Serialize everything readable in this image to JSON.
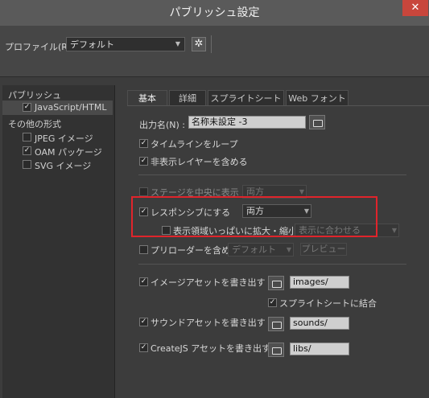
{
  "window": {
    "title": "パブリッシュ設定",
    "close_symbol": "✕"
  },
  "profile": {
    "label": "プロファイル(R) :",
    "value": "デフォルト",
    "arrow": "▼",
    "gear": "✲"
  },
  "sidebar": {
    "publish_header": "パブリッシュ",
    "js_html": {
      "label": "JavaScript/HTML",
      "checked": true
    },
    "other_header": "その他の形式",
    "jpeg": {
      "label": "JPEG イメージ",
      "checked": false
    },
    "oam": {
      "label": "OAM パッケージ",
      "checked": true
    },
    "svg": {
      "label": "SVG イメージ",
      "checked": false
    }
  },
  "tabs": [
    "基本",
    "詳細",
    "スプライトシート",
    "Web フォント"
  ],
  "basic": {
    "output_label": "出力名(N) :",
    "output_value": "名称未設定 -3",
    "loop_timeline": {
      "label": "タイムラインをループ",
      "checked": true
    },
    "include_hidden": {
      "label": "非表示レイヤーを含める",
      "checked": true
    },
    "center_stage": {
      "label": "ステージを中央に表示",
      "checked": false,
      "dropdown": "両方"
    },
    "responsive": {
      "label": "レスポンシブにする",
      "checked": true,
      "dropdown": "両方"
    },
    "scale_fill": {
      "label": "表示領域いっぱいに拡大・縮小",
      "checked": false,
      "dropdown": "表示に合わせる"
    },
    "preloader": {
      "label": "プリローダーを含める",
      "checked": false,
      "dropdown": "デフォルト",
      "preview_button": "プレビュー"
    },
    "export_images": {
      "label": "イメージアセットを書き出す :",
      "checked": true,
      "path": "images/"
    },
    "combine_sprites": {
      "label": "スプライトシートに結合",
      "checked": true
    },
    "export_sounds": {
      "label": "サウンドアセットを書き出す :",
      "checked": true,
      "path": "sounds/"
    },
    "export_createjs": {
      "label": "CreateJS アセットを書き出す :",
      "checked": true,
      "path": "libs/"
    }
  },
  "colors": {
    "highlight": "#e0242b",
    "close": "#c8463c"
  }
}
